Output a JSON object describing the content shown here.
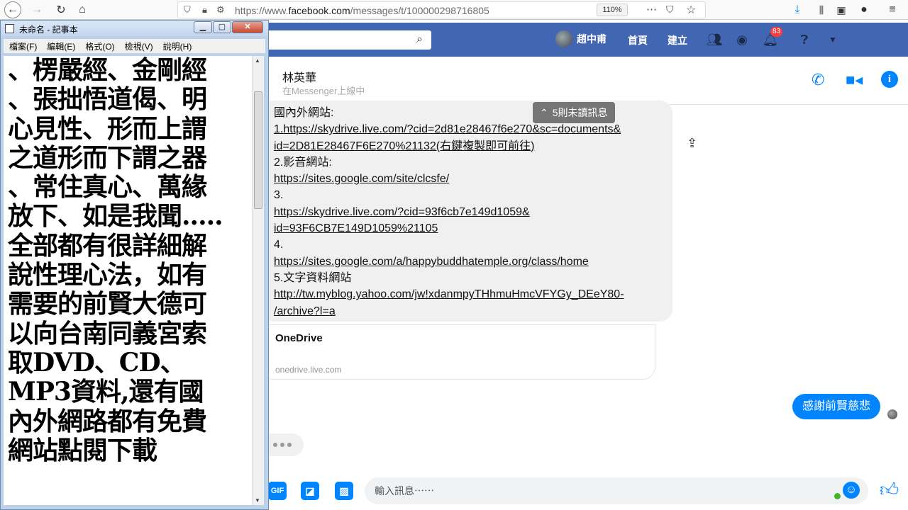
{
  "browser": {
    "url_prefix": "https://www.",
    "url_domain": "facebook.com",
    "url_path": "/messages/t/100000298716805",
    "zoom": "110%"
  },
  "fb": {
    "user_name": "趙中甫",
    "nav_home": "首頁",
    "nav_create": "建立",
    "notif_count": "83"
  },
  "chat": {
    "contact_name": "林英華",
    "contact_status": "在Messenger上線中",
    "unread_pill": "5則未讀訊息",
    "message_lines": [
      "國內外網站:",
      "1.https://skydrive.live.com/?cid=2d81e28467f6e270&sc=documents&",
      "id=2D81E28467F6E270%21132(右鍵複製即可前往)",
      "2.影音網站:",
      "https://sites.google.com/site/clcsfe/",
      "3.",
      "https://skydrive.live.com/?cid=93f6cb7e149d1059&",
      "id=93F6CB7E149D1059%21105",
      "4.",
      "https://sites.google.com/a/happybuddhatemple.org/class/home",
      "5.文字資料網站",
      "http://tw.myblog.yahoo.com/jw!xdanmpyTHhmuHmcVFYGy_DEeY80-",
      "/archive?l=a"
    ],
    "link_card_title": "OneDrive",
    "link_card_domain": "onedrive.live.com",
    "outgoing_message": "感謝前賢慈悲",
    "composer_placeholder": "輸入訊息⋯⋯",
    "composer_gif_label": "GIF"
  },
  "notepad": {
    "title": "未命名 - 記事本",
    "menus": [
      "檔案(F)",
      "編輯(E)",
      "格式(O)",
      "檢視(V)",
      "說明(H)"
    ],
    "lines": [
      "、楞嚴經、金剛經",
      "、張拙悟道偈、明",
      "心見性、形而上謂",
      "之道形而下謂之器",
      "、常住真心、萬緣",
      "放下、如是我聞.....",
      "全部都有很詳細解",
      "說性理心法，如有",
      "需要的前賢大德可",
      "以向台南同義宮索",
      "取DVD、CD、",
      "MP3資料,還有國",
      "內外網路都有免費",
      "網站點閱下載"
    ]
  },
  "colors": {
    "fb_blue": "#4267b2",
    "messenger_blue": "#0084ff",
    "incoming_bubble": "#f1f0f0"
  }
}
